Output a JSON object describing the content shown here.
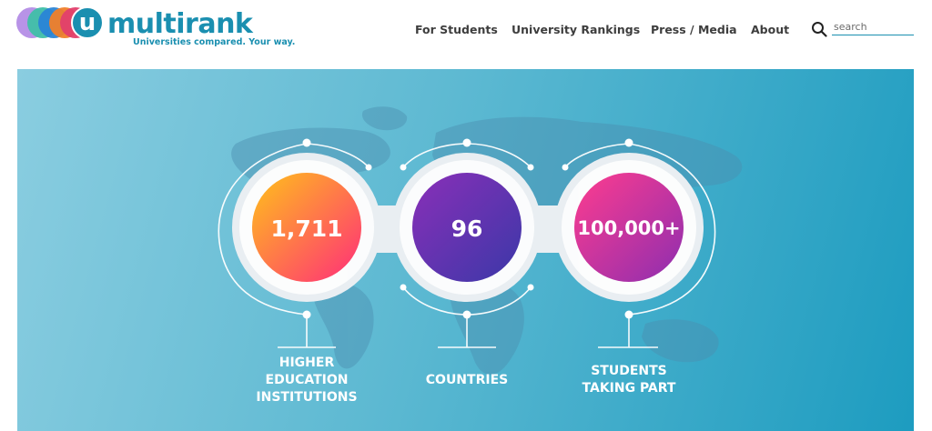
{
  "brand": {
    "letter": "u",
    "name": "multirank",
    "tagline": "Universities compared. Your way."
  },
  "nav": [
    {
      "label": "For Students"
    },
    {
      "label": "University Rankings"
    },
    {
      "label": "Press / Media"
    },
    {
      "label": "About"
    }
  ],
  "search": {
    "placeholder": "search",
    "value": ""
  },
  "stats": [
    {
      "value": "1,711",
      "label": "HIGHER\nEDUCATION\nINSTITUTIONS"
    },
    {
      "value": "96",
      "label": "COUNTRIES"
    },
    {
      "value": "100,000+",
      "label": "STUDENTS\nTAKING PART"
    }
  ],
  "colors": {
    "brand": "#1a8fb0",
    "stat1_from": "#ffc21a",
    "stat1_to": "#ff2d7a",
    "stat2_from": "#8a2fb8",
    "stat2_to": "#3b38a8",
    "stat3_from": "#ff3c8e",
    "stat3_to": "#8d2eb0"
  }
}
